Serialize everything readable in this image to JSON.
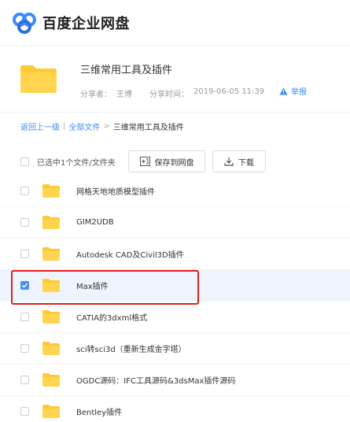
{
  "header": {
    "logo_text": "百度企业网盘"
  },
  "share": {
    "title": "三维常用工具及插件",
    "sharer_label": "分享者：",
    "sharer_name": "王博",
    "time_label": "分享时间：",
    "time_value": "2019-06-05 11:39",
    "report_label": "举报"
  },
  "breadcrumb": {
    "back": "返回上一级",
    "divider": "|",
    "all_files": "全部文件",
    "arrow": ">",
    "current": "三维常用工具及插件"
  },
  "toolbar": {
    "selection_text": "已选中1个文件/文件夹",
    "save_label": "保存到网盘",
    "download_label": "下载"
  },
  "files": [
    {
      "name": "网格天地地质模型插件",
      "selected": false
    },
    {
      "name": "GIM2UDB",
      "selected": false
    },
    {
      "name": "Autodesk CAD及Civil3D插件",
      "selected": false
    },
    {
      "name": "Max插件",
      "selected": true
    },
    {
      "name": "CATIA的3dxml格式",
      "selected": false
    },
    {
      "name": "sci转sci3d（重新生成金字塔）",
      "selected": false
    },
    {
      "name": "OGDC源码：IFC工具源码&3dsMax插件源码",
      "selected": false
    },
    {
      "name": "Bentley插件",
      "selected": false
    }
  ],
  "colors": {
    "accent": "#3b8cff",
    "folder": "#ffc933",
    "highlight": "#e21e1e",
    "selected_row": "#eef4fd"
  }
}
